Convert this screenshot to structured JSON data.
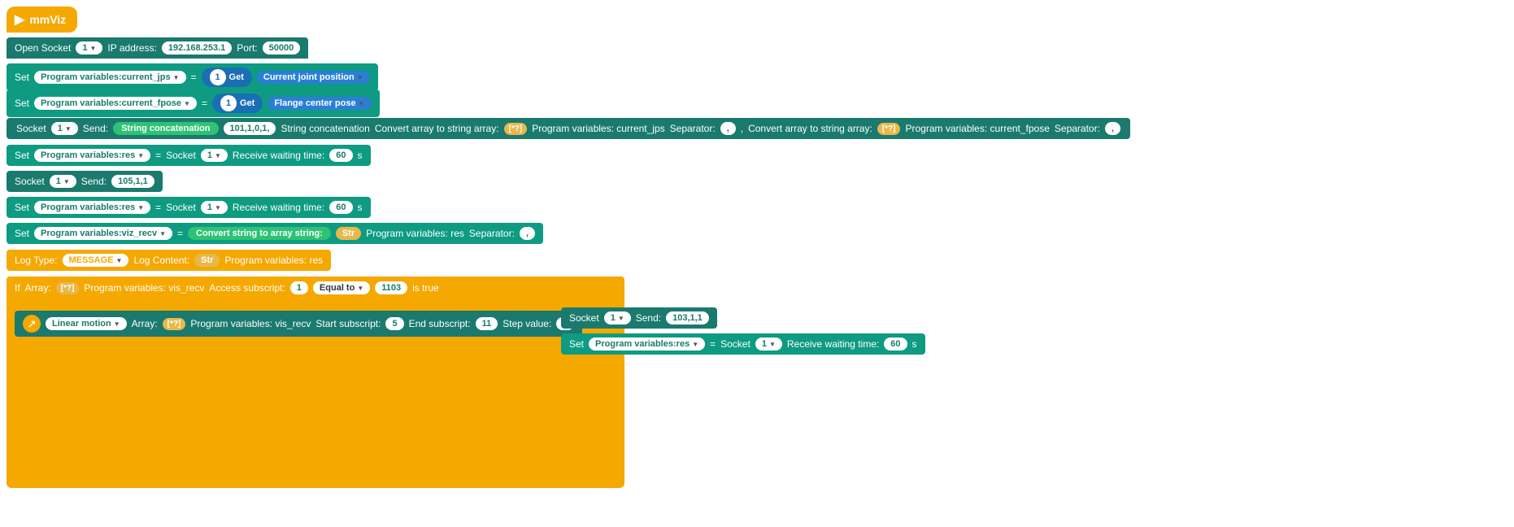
{
  "app": {
    "name": "mmViz",
    "logo_arrow": "▶"
  },
  "blocks": {
    "open_socket": {
      "label": "Open Socket",
      "socket_num": "1",
      "ip_label": "IP address:",
      "ip_value": "192.168.253.1",
      "port_label": "Port:",
      "port_value": "50000"
    },
    "set1": {
      "set_label": "Set",
      "var_label": "Program variables:current_jps",
      "equals": "=",
      "get_label": "Get",
      "get_value": "Current joint position"
    },
    "set2": {
      "set_label": "Set",
      "var_label": "Program variables:current_fpose",
      "equals": "=",
      "get_label": "Get",
      "get_value": "Flange center pose"
    },
    "socket_send1": {
      "socket_label": "Socket",
      "socket_num": "1",
      "send_label": "Send:",
      "concat_label": "String concatenation",
      "value1": "101,1,0,1,",
      "concat_label2": "String concatenation",
      "convert_label": "Convert array to string array:",
      "arr_icon": "[*?]",
      "var1": "Program variables: current_jps",
      "sep_label": "Separator:",
      "sep1": ",",
      "convert_label2": "Convert array to string array:",
      "arr_icon2": "[*?]",
      "var2": "Program variables: current_fpose",
      "sep_label2": "Separator:",
      "sep2": ","
    },
    "set3": {
      "set_label": "Set",
      "var_label": "Program variables:res",
      "equals": "=",
      "socket_label": "Socket",
      "socket_num": "1",
      "receive_label": "Receive waiting time:",
      "time_val": "60",
      "s_label": "s"
    },
    "socket_send2": {
      "socket_label": "Socket",
      "socket_num": "1",
      "send_label": "Send:",
      "send_value": "105,1,1"
    },
    "set4": {
      "set_label": "Set",
      "var_label": "Program variables:res",
      "equals": "=",
      "socket_label": "Socket",
      "socket_num": "1",
      "receive_label": "Receive waiting time:",
      "time_val": "60",
      "s_label": "s"
    },
    "set5": {
      "set_label": "Set",
      "var_label": "Program variables:viz_recv",
      "equals": "=",
      "convert_label": "Convert string to array string:",
      "str_icon": "Str",
      "var_ref": "Program variables: res",
      "sep_label": "Separator:",
      "sep_val": ","
    },
    "log": {
      "log_type_label": "Log Type:",
      "log_type_val": "MESSAGE",
      "log_content_label": "Log Content:",
      "str_icon": "Str",
      "log_var": "Program variables: res"
    },
    "if_block": {
      "if_label": "If",
      "array_label": "Array:",
      "arr_icon": "[*?]",
      "var_ref": "Program variables: vis_recv",
      "access_label": "Access subscript:",
      "subscript_val": "1",
      "equal_label": "Equal to",
      "equal_val": "1103",
      "is_true_label": "is true"
    },
    "linear_motion": {
      "motion_label": "Linear motion",
      "array_label": "Array:",
      "arr_icon": "[*?]",
      "var_ref": "Program variables: vis_recv",
      "start_label": "Start subscript:",
      "start_val": "5",
      "end_label": "End subscript:",
      "end_val": "11",
      "step_label": "Step value:",
      "step_val": "1"
    },
    "socket_send3": {
      "socket_label": "Socket",
      "socket_num": "1",
      "send_label": "Send:",
      "send_value": "103,1,1"
    },
    "set6": {
      "set_label": "Set",
      "var_label": "Program variables:res",
      "equals": "=",
      "socket_label": "Socket",
      "socket_num": "1",
      "receive_label": "Receive waiting time:",
      "time_val": "60",
      "s_label": "s"
    }
  },
  "colors": {
    "dark_teal": "#1a7a6e",
    "teal": "#1dab8e",
    "green": "#2ec275",
    "orange": "#F5A800",
    "blue": "#1a6eb5",
    "mid_teal": "#0e9b82",
    "light_green": "#29b86d"
  }
}
